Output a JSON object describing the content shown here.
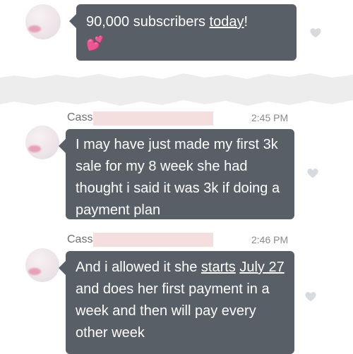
{
  "messages": [
    {
      "text_parts": [
        {
          "text": "90,000 subscribers ",
          "underline": false
        },
        {
          "text": "today",
          "underline": true
        },
        {
          "text": "!",
          "underline": false
        }
      ],
      "emoji": "💕",
      "icons": {
        "like": "heart-icon"
      }
    },
    {
      "sender_name": "Cass",
      "time": "2:45 PM",
      "text": "I may have just made my first 3k sale for my 8 week she had thought i said it was 3k if doing a payment plan",
      "icons": {
        "like": "heart-icon"
      }
    },
    {
      "sender_name": "Cass",
      "time": "2:46 PM",
      "text_parts": [
        {
          "text": "And i allowed it she ",
          "underline": false
        },
        {
          "text": "starts",
          "underline": true
        },
        {
          "text": " ",
          "underline": false
        },
        {
          "text": "July 27",
          "underline": true
        },
        {
          "text": " and does her first payment in a week and then will pay every other week",
          "underline": false
        }
      ],
      "icons": {
        "like": "heart-icon"
      }
    }
  ],
  "colors": {
    "bubble": "#595f66",
    "text": "#ffffff",
    "meta": "#8a8a8a",
    "redaction": "#f3dcdc",
    "like": "#d7dbe0"
  }
}
